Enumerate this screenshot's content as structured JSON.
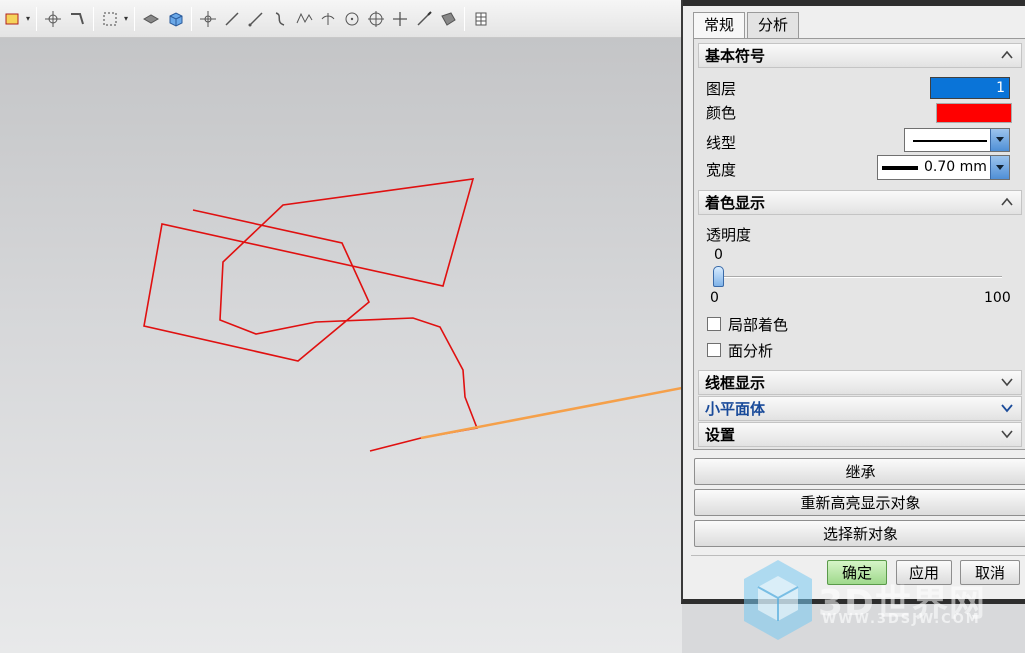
{
  "toolbar": {
    "icons": [
      "layer-icon",
      "snap-icon",
      "measure-icon",
      "select-box-icon",
      "shaded-view-icon",
      "cube-view-icon",
      "move-icon",
      "line-icon",
      "line-tool-icon",
      "arc-icon",
      "spline-icon",
      "point-icon",
      "circle-icon",
      "circle-center-icon",
      "crosshair-icon",
      "pen-icon",
      "surface-icon",
      "table-icon"
    ]
  },
  "dialog": {
    "tabs": [
      {
        "label": "常规",
        "active": true
      },
      {
        "label": "分析",
        "active": false
      }
    ],
    "sections": {
      "basic": {
        "title": "基本符号",
        "layer_label": "图层",
        "layer_value": "1",
        "color_label": "颜色",
        "color_value": "#ff0000",
        "linetype_label": "线型",
        "width_label": "宽度",
        "width_value": "0.70 mm"
      },
      "shading": {
        "title": "着色显示",
        "transparency_label": "透明度",
        "transparency_value": "0",
        "slider_min": "0",
        "slider_max": "100",
        "local_shading_label": "局部着色",
        "face_analysis_label": "面分析"
      },
      "wireframe": {
        "title": "线框显示"
      },
      "facet": {
        "title": "小平面体"
      },
      "settings": {
        "title": "设置"
      }
    },
    "buttons": {
      "inherit": "继承",
      "rehighlight": "重新高亮显示对象",
      "select_new": "选择新对象",
      "ok": "确定",
      "apply": "应用",
      "cancel": "取消"
    }
  },
  "colors": {
    "curve": "#e01010",
    "highlight": "#f5a04a",
    "accent": "#1a4b9a",
    "selection": "#0a74d8"
  },
  "watermark": {
    "text": "3D世界网",
    "url": "WWW.3DSJW.COM"
  }
}
